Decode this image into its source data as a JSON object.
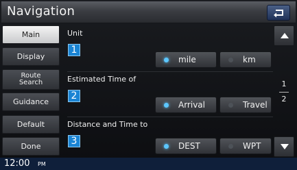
{
  "header": {
    "title": "Navigation",
    "back_icon": "return-arrow-icon"
  },
  "tabs": [
    {
      "label": "Main",
      "active": true
    },
    {
      "label": "Display"
    },
    {
      "label": "Route Search"
    },
    {
      "label": "Guidance"
    },
    {
      "label": "Default"
    },
    {
      "label": "Done"
    }
  ],
  "settings": [
    {
      "badge": "1",
      "label": "Unit",
      "options": [
        {
          "label": "mile",
          "selected": true
        },
        {
          "label": "km",
          "selected": false
        }
      ]
    },
    {
      "badge": "2",
      "label": "Estimated Time of",
      "options": [
        {
          "label": "Arrival",
          "selected": true
        },
        {
          "label": "Travel",
          "selected": false
        }
      ]
    },
    {
      "badge": "3",
      "label": "Distance and Time to",
      "options": [
        {
          "label": "DEST",
          "selected": true
        },
        {
          "label": "WPT",
          "selected": false
        }
      ]
    }
  ],
  "pager": {
    "current": "1",
    "total": "2",
    "up_icon": "scroll-up-icon",
    "down_icon": "scroll-down-icon"
  },
  "status": {
    "time": "12:00",
    "ampm": "PM"
  },
  "colors": {
    "badge_blue": "#1a84d4",
    "selected_dot": "#5cc7ff",
    "status_bar": "#0f1f3a"
  }
}
